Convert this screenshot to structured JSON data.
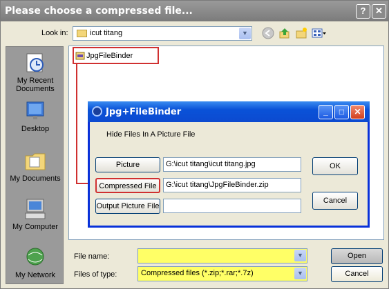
{
  "window": {
    "title": "Please choose a compressed file...",
    "help_glyph": "?",
    "close_glyph": "✕"
  },
  "toolbar": {
    "lookin_label": "Look in:",
    "lookin_value": "icut titang"
  },
  "places": [
    {
      "label_line1": "My Recent",
      "label_line2": "Documents",
      "icon": "recent-documents-icon"
    },
    {
      "label_line1": "Desktop",
      "label_line2": "",
      "icon": "desktop-icon"
    },
    {
      "label_line1": "My Documents",
      "label_line2": "",
      "icon": "my-documents-icon"
    },
    {
      "label_line1": "My Computer",
      "label_line2": "",
      "icon": "my-computer-icon"
    },
    {
      "label_line1": "My Network",
      "label_line2": "",
      "icon": "my-network-icon"
    }
  ],
  "files": [
    {
      "name": "JpgFileBinder",
      "icon": "zip-archive-icon"
    }
  ],
  "bottom": {
    "filename_label": "File name:",
    "filename_value": "",
    "filetype_label": "Files of type:",
    "filetype_value": "Compressed files (*.zip;*.rar;*.7z)",
    "open_label": "Open",
    "cancel_label": "Cancel"
  },
  "binder": {
    "title": "Jpg+FileBinder",
    "subtitle": "Hide Files In A Picture File",
    "picture_button": "Picture",
    "picture_path": "G:\\icut titang\\icut titang.jpg",
    "compressed_button": "Compressed File",
    "compressed_path": "G:\\icut titang\\JpgFileBinder.zip",
    "output_button": "Output Picture File",
    "output_path": "",
    "ok_label": "OK",
    "cancel_label": "Cancel",
    "min_glyph": "_",
    "max_glyph": "□",
    "close_glyph": "✕"
  },
  "colors": {
    "highlight": "#ffff66",
    "annotation": "#d03030",
    "xp_blue": "#0a52d8"
  }
}
